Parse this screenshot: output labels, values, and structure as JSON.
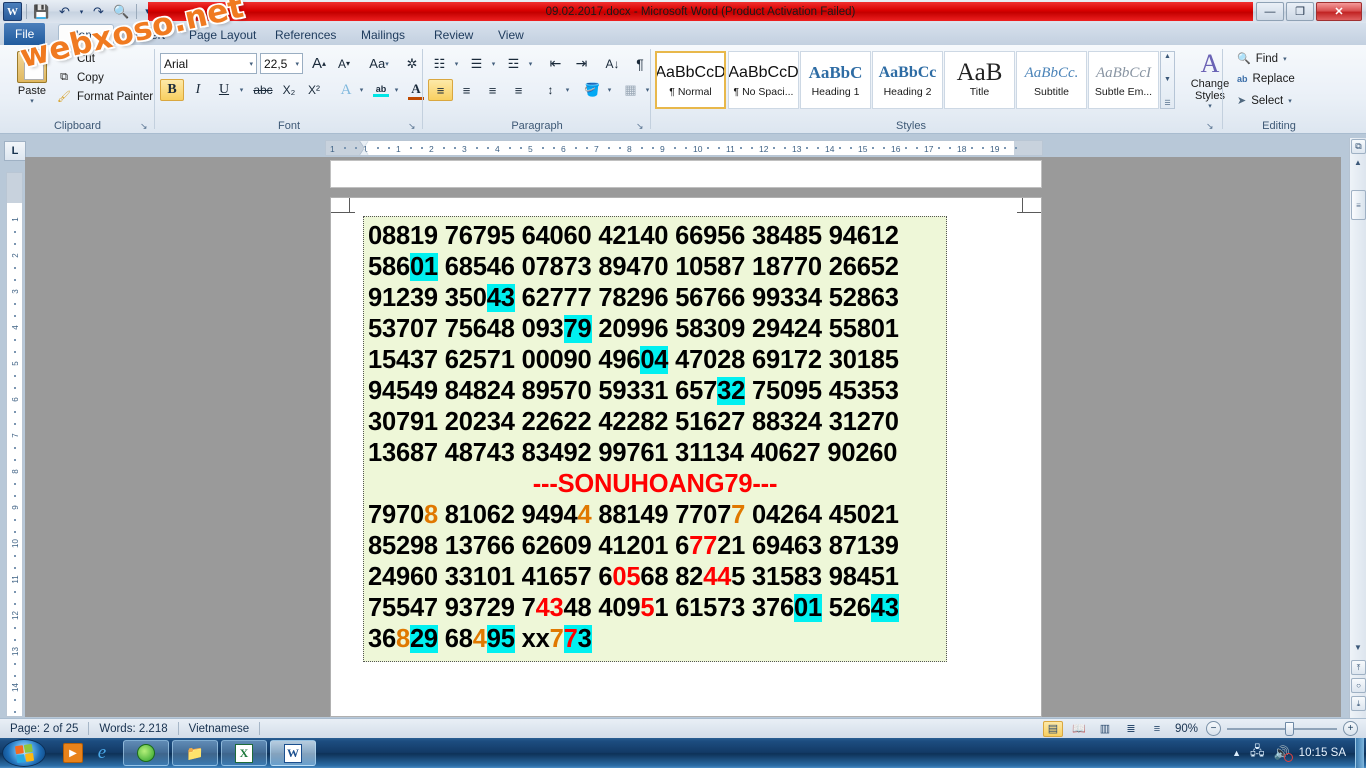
{
  "window": {
    "title": "09.02.2017.docx  -  Microsoft Word (Product Activation Failed)",
    "minimize": "—",
    "restore": "❐",
    "close": "✕",
    "logo_text": "W"
  },
  "quick_access": {
    "save": "💾",
    "undo": "↶",
    "undo_arrow": "▾",
    "redo": "↷",
    "print_preview": "🔍",
    "customize": "▾"
  },
  "watermark": {
    "text": "webxoso.net"
  },
  "tabs": [
    {
      "label": "File",
      "state": "file"
    },
    {
      "label": "Home",
      "state": "active"
    },
    {
      "label": "Insert",
      "state": "normal"
    },
    {
      "label": "Page Layout",
      "state": "normal"
    },
    {
      "label": "References",
      "state": "normal"
    },
    {
      "label": "Mailings",
      "state": "normal"
    },
    {
      "label": "Review",
      "state": "normal"
    },
    {
      "label": "View",
      "state": "normal"
    }
  ],
  "tab_help": {
    "collapse": "⌃",
    "help": "?"
  },
  "ribbon": {
    "clipboard": {
      "label": "Clipboard",
      "paste": "Paste",
      "cut": "Cut",
      "cut_icon": "✂",
      "copy": "Copy",
      "copy_icon": "⧉",
      "format_painter": "Format Painter",
      "format_painter_icon": "🖌",
      "launcher": "↘"
    },
    "font": {
      "label": "Font",
      "name": "Arial",
      "size": "22,5",
      "grow": "A▴",
      "shrink": "A▾",
      "change_case": "Aa",
      "clear_formatting": "⌫",
      "bold": "B",
      "italic": "I",
      "underline": "U",
      "strikethrough": "abc",
      "subscript": "X₂",
      "superscript": "X²",
      "text_effects": "A",
      "highlight": "ab",
      "font_color": "A",
      "launcher": "↘"
    },
    "paragraph": {
      "label": "Paragraph",
      "bullets": "☷",
      "numbering": "☰",
      "multilevel": "☲",
      "decrease_indent": "⇤",
      "increase_indent": "⇥",
      "sort": "A↓",
      "show_marks": "¶",
      "align_left": "≡",
      "align_center": "≡",
      "align_right": "≡",
      "justify": "≡",
      "line_spacing": "↕",
      "shading": "🪣",
      "borders": "▦",
      "launcher": "↘"
    },
    "styles": {
      "label": "Styles",
      "items": [
        {
          "preview": "AaBbCcD",
          "name": "¶ Normal",
          "selected": true
        },
        {
          "preview": "AaBbCcD",
          "name": "¶ No Spaci...",
          "selected": false
        },
        {
          "preview": "AaBbC",
          "name": "Heading 1",
          "selected": false
        },
        {
          "preview": "AaBbCc",
          "name": "Heading 2",
          "selected": false
        },
        {
          "preview": "AaB",
          "name": "Title",
          "selected": false
        },
        {
          "preview": "AaBbCc.",
          "name": "Subtitle",
          "selected": false
        },
        {
          "preview": "AaBbCcI",
          "name": "Subtle Em...",
          "selected": false
        }
      ],
      "change_styles": "Change Styles",
      "scroll_up": "▲",
      "scroll_down": "▼",
      "scroll_more": "☰",
      "launcher": "↘"
    },
    "editing": {
      "label": "Editing",
      "find": "Find",
      "find_icon": "🔍",
      "replace": "Replace",
      "replace_icon": "ab",
      "select": "Select",
      "select_icon": "➤",
      "arrow": "▾"
    }
  },
  "ruler": {
    "corner_icon": "L",
    "h_ticks": [
      "1",
      "1",
      "1",
      "2",
      "3",
      "4",
      "5",
      "6",
      "7",
      "8",
      "9",
      "10",
      "11",
      "12",
      "13",
      "14",
      "15",
      "16",
      "17",
      "18",
      "19"
    ],
    "v_ticks": [
      "1",
      "2",
      "3",
      "4",
      "5",
      "6",
      "7",
      "8",
      "9",
      "10",
      "11",
      "12",
      "13",
      "14"
    ]
  },
  "document": {
    "lines": [
      {
        "align": "left",
        "parts": [
          {
            "t": "08819 76795 64060 42140 66956 38485 94612",
            "c": "k"
          }
        ]
      },
      {
        "align": "left",
        "parts": [
          {
            "t": "586",
            "c": "k"
          },
          {
            "t": "01",
            "c": "hl"
          },
          {
            "t": " 68546 07873 89470 10587 18770 26652",
            "c": "k"
          }
        ]
      },
      {
        "align": "left",
        "parts": [
          {
            "t": "91239 350",
            "c": "k"
          },
          {
            "t": "43",
            "c": "hl"
          },
          {
            "t": " 62777 78296 56766 99334 52863",
            "c": "k"
          }
        ]
      },
      {
        "align": "left",
        "parts": [
          {
            "t": "53707 75648 093",
            "c": "k"
          },
          {
            "t": "79",
            "c": "hl"
          },
          {
            "t": " 20996 58309 29424 55801",
            "c": "k"
          }
        ]
      },
      {
        "align": "left",
        "parts": [
          {
            "t": "15437 62571 00090 496",
            "c": "k"
          },
          {
            "t": "04",
            "c": "hl"
          },
          {
            "t": " 47028 69172 30185",
            "c": "k"
          }
        ]
      },
      {
        "align": "left",
        "parts": [
          {
            "t": "94549 84824 89570 59331 657",
            "c": "k"
          },
          {
            "t": "32",
            "c": "hl"
          },
          {
            "t": " 75095 45353",
            "c": "k"
          }
        ]
      },
      {
        "align": "left",
        "parts": [
          {
            "t": "30791 20234 22622 42282 51627 88324 31270",
            "c": "k"
          }
        ]
      },
      {
        "align": "left",
        "parts": [
          {
            "t": "13687 48743 83492 99761 31134 40627 90260",
            "c": "k"
          }
        ]
      },
      {
        "align": "center",
        "parts": [
          {
            "t": "---SONUHOANG79---",
            "c": "rd"
          }
        ]
      },
      {
        "align": "left",
        "parts": [
          {
            "t": "7970",
            "c": "k"
          },
          {
            "t": "8",
            "c": "or"
          },
          {
            "t": " 81062 9494",
            "c": "k"
          },
          {
            "t": "4",
            "c": "or"
          },
          {
            "t": " 88149 7707",
            "c": "k"
          },
          {
            "t": "7",
            "c": "or"
          },
          {
            "t": " 04264 45021",
            "c": "k"
          }
        ]
      },
      {
        "align": "left",
        "parts": [
          {
            "t": "85298 13766 62609 41201 6",
            "c": "k"
          },
          {
            "t": "77",
            "c": "rd"
          },
          {
            "t": "21 69463 87139",
            "c": "k"
          }
        ]
      },
      {
        "align": "left",
        "parts": [
          {
            "t": "24960 33101 41657 6",
            "c": "k"
          },
          {
            "t": "05",
            "c": "rd"
          },
          {
            "t": "68 82",
            "c": "k"
          },
          {
            "t": "4",
            "c": "rd"
          },
          {
            "t": "4",
            "c": "rd"
          },
          {
            "t": "5 31583 98451",
            "c": "k"
          }
        ]
      },
      {
        "align": "left",
        "parts": [
          {
            "t": "75547 93729 7",
            "c": "k"
          },
          {
            "t": "43",
            "c": "rd"
          },
          {
            "t": "48 409",
            "c": "k"
          },
          {
            "t": "5",
            "c": "rd"
          },
          {
            "t": "1 61573 376",
            "c": "k"
          },
          {
            "t": "01",
            "c": "hl"
          },
          {
            "t": " 526",
            "c": "k"
          },
          {
            "t": "43",
            "c": "hl"
          }
        ]
      },
      {
        "align": "left",
        "parts": [
          {
            "t": "36",
            "c": "k"
          },
          {
            "t": "8",
            "c": "or"
          },
          {
            "t": "29",
            "c": "hl"
          },
          {
            "t": " 68",
            "c": "k"
          },
          {
            "t": "4",
            "c": "or"
          },
          {
            "t": "95",
            "c": "hl"
          },
          {
            "t": " xx",
            "c": "k"
          },
          {
            "t": "7",
            "c": "or"
          },
          {
            "t": "7",
            "c": "hl-rd"
          },
          {
            "t": "3",
            "c": "hl"
          }
        ]
      }
    ],
    "highlight_color": "#00f0f0",
    "background_color": "#eef7d8",
    "orange_color": "#e07800",
    "red_color": "#ff0000"
  },
  "status_bar": {
    "page": "Page: 2 of 25",
    "words": "Words: 2.218",
    "language": "Vietnamese",
    "zoom": "90%",
    "zoom_out": "−",
    "zoom_in": "+",
    "views": [
      {
        "name": "print-layout",
        "glyph": "▤",
        "active": true
      },
      {
        "name": "full-screen-reading",
        "glyph": "📖",
        "active": false
      },
      {
        "name": "web-layout",
        "glyph": "▥",
        "active": false
      },
      {
        "name": "outline",
        "glyph": "≣",
        "active": false
      },
      {
        "name": "draft",
        "glyph": "≡",
        "active": false
      }
    ]
  },
  "scrollbar": {
    "up": "▲",
    "down": "▼",
    "thumb": "≡",
    "split": "▬",
    "select_object": "⧉",
    "prev_page": "⤒",
    "browse_object": "○",
    "next_page": "⤓"
  },
  "taskbar": {
    "start": "start-orb",
    "launch_icons": [
      {
        "name": "media-player-icon",
        "glyph": "▶",
        "bg": "#e8821a"
      },
      {
        "name": "internet-explorer-icon",
        "glyph": "e",
        "bg": "none"
      }
    ],
    "tasks": [
      {
        "name": "unikey-task",
        "glyph": "◔",
        "active": false
      },
      {
        "name": "explorer-task",
        "glyph": "📁",
        "active": false
      },
      {
        "name": "excel-task",
        "glyph": "X",
        "active": false
      },
      {
        "name": "word-task",
        "glyph": "W",
        "active": true
      }
    ],
    "tray": {
      "expand": "▲",
      "network": "🖧",
      "volume": "🔊",
      "clock": "10:15 SA"
    }
  }
}
